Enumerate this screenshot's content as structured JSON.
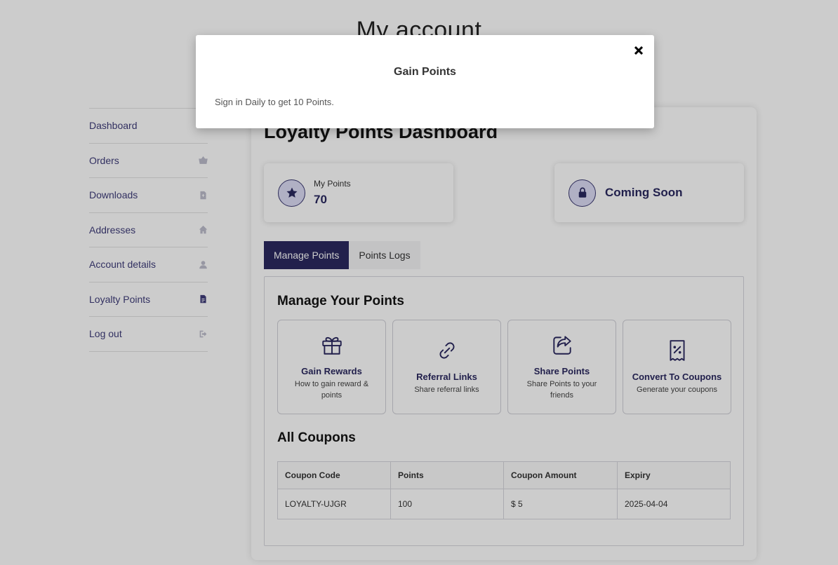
{
  "page": {
    "title": "My account"
  },
  "sidebar": {
    "items": [
      {
        "label": "Dashboard",
        "icon": "dashboard-icon"
      },
      {
        "label": "Orders",
        "icon": "basket-icon"
      },
      {
        "label": "Downloads",
        "icon": "file-download-icon"
      },
      {
        "label": "Addresses",
        "icon": "home-icon"
      },
      {
        "label": "Account details",
        "icon": "user-icon"
      },
      {
        "label": "Loyalty Points",
        "icon": "document-icon",
        "active": true
      },
      {
        "label": "Log out",
        "icon": "sign-out-icon"
      }
    ]
  },
  "dashboard": {
    "title": "Loyalty Points Dashboard",
    "my_points": {
      "label": "My Points",
      "value": "70",
      "icon": "star-icon"
    },
    "coming_soon": {
      "label": "Coming Soon",
      "icon": "lock-icon"
    },
    "tabs": [
      {
        "label": "Manage Points",
        "active": true
      },
      {
        "label": "Points Logs",
        "active": false
      }
    ],
    "manage_title": "Manage Your Points",
    "actions": [
      {
        "title": "Gain Rewards",
        "desc": "How to gain reward & points",
        "icon": "gift-icon"
      },
      {
        "title": "Referral Links",
        "desc": "Share referral links",
        "icon": "link-icon"
      },
      {
        "title": "Share Points",
        "desc": "Share Points to your friends",
        "icon": "share-icon"
      },
      {
        "title": "Convert To Coupons",
        "desc": "Generate your coupons",
        "icon": "coupon-icon"
      }
    ],
    "coupons_title": "All Coupons",
    "coupons_table": {
      "headers": [
        "Coupon Code",
        "Points",
        "Coupon Amount",
        "Expiry"
      ],
      "rows": [
        [
          "LOYALTY-UJGR",
          "100",
          "$ 5",
          "2025-04-04"
        ]
      ]
    }
  },
  "modal": {
    "title": "Gain Points",
    "body": "Sign in Daily to get 10 Points.",
    "close_icon": "close-icon"
  },
  "colors": {
    "primary": "#2b2960",
    "link": "#3f3d7a",
    "overlay": "rgba(0,0,0,0.2)"
  }
}
